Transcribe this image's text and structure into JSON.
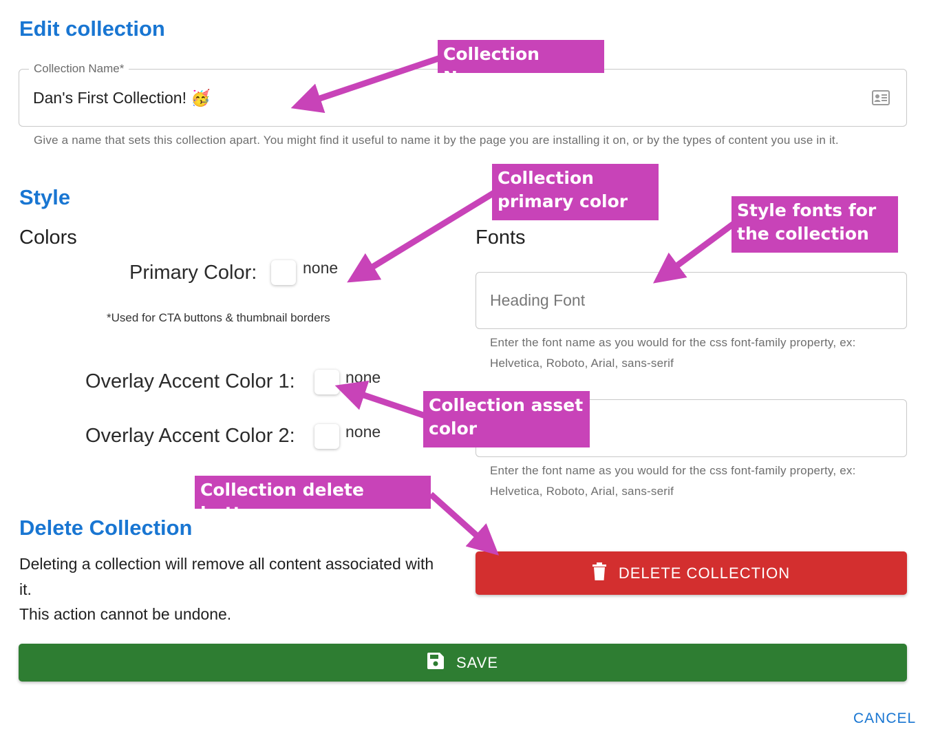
{
  "page": {
    "title": "Edit collection"
  },
  "collection_name": {
    "label": "Collection Name",
    "required_mark": "*",
    "value": "Dan's First Collection! 🥳",
    "icon": "contact-card-icon",
    "helper": "Give a name that sets this collection apart. You might find it useful to name it by the page you are installing it on, or by the types of content you use in it."
  },
  "style": {
    "title": "Style",
    "colors": {
      "heading": "Colors",
      "primary": {
        "label": "Primary Color:",
        "value": "none",
        "note": "*Used for CTA buttons & thumbnail borders"
      },
      "accent1": {
        "label": "Overlay Accent Color 1:",
        "value": "none"
      },
      "accent2": {
        "label": "Overlay Accent Color 2:",
        "value": "none"
      }
    },
    "fonts": {
      "heading": "Fonts",
      "heading_font": {
        "placeholder": "Heading Font",
        "helper": "Enter the font name as you would for the css font-family property, ex: Helvetica, Roboto, Arial, sans-serif"
      },
      "body_font": {
        "placeholder": "",
        "helper": "Enter the font name as you would for the css font-family property, ex: Helvetica, Roboto, Arial, sans-serif"
      }
    }
  },
  "delete": {
    "title": "Delete Collection",
    "description_line1": "Deleting a collection will remove all content associated with it.",
    "description_line2": "This action cannot be undone.",
    "button_label": "DELETE COLLECTION",
    "button_icon": "trash-icon"
  },
  "actions": {
    "save_label": "SAVE",
    "save_icon": "floppy-disk-icon",
    "cancel_label": "CANCEL"
  },
  "annotations": {
    "collection_name": "Collection Name",
    "primary_color": "Collection primary color",
    "fonts": "Style fonts for the collection",
    "asset_color": "Collection asset color",
    "delete_button": "Collection delete button"
  },
  "colors": {
    "link_blue": "#1976d2",
    "delete_red": "#d32f2f",
    "save_green": "#2e7d32",
    "annotation_magenta": "#c843b8"
  }
}
